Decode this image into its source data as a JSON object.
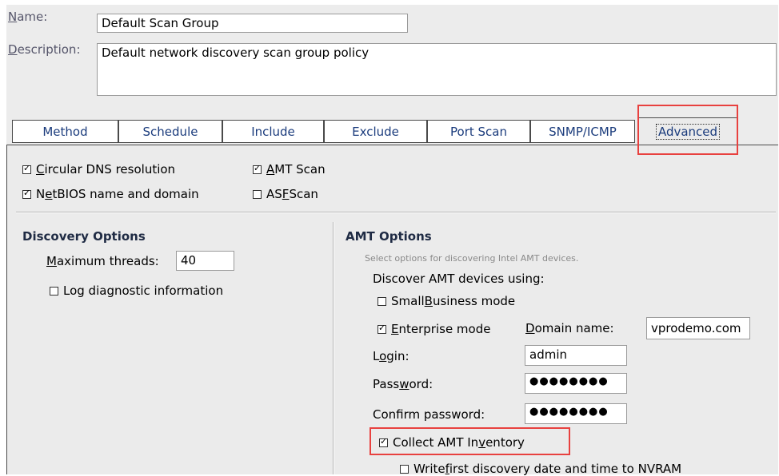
{
  "form": {
    "name_label": "Name:",
    "name_value": "Default Scan Group",
    "description_label": "Description:",
    "description_value": "Default network discovery scan group policy"
  },
  "tabs": [
    {
      "label": "Method"
    },
    {
      "label": "Schedule"
    },
    {
      "label": "Include"
    },
    {
      "label": "Exclude"
    },
    {
      "label": "Port Scan"
    },
    {
      "label": "SNMP/ICMP"
    },
    {
      "label": "Advanced",
      "active": true
    }
  ],
  "scan_options": {
    "circular_dns": {
      "pre": "",
      "mn": "C",
      "post": "ircular DNS resolution",
      "checked": true
    },
    "netbios": {
      "pre": "N",
      "mn": "e",
      "post": "tBIOS name and domain",
      "checked": true
    },
    "amt_scan": {
      "pre": "",
      "mn": "A",
      "post": "MT Scan",
      "checked": true
    },
    "asf_scan": {
      "pre": "AS",
      "mn": "F",
      "post": " Scan",
      "checked": false
    }
  },
  "discovery": {
    "title": "Discovery Options",
    "max_threads": {
      "pre": "",
      "mn": "M",
      "post": "aximum threads:",
      "value": "40"
    },
    "log_diag": {
      "label": "Log diagnostic information",
      "checked": false
    }
  },
  "amt": {
    "title": "AMT Options",
    "hint": "Select options for discovering Intel AMT devices.",
    "discover_label": "Discover AMT devices using:",
    "small_business": {
      "pre": "Small ",
      "mn": "B",
      "post": "usiness mode",
      "checked": false
    },
    "enterprise": {
      "pre": "",
      "mn": "E",
      "post": "nterprise mode",
      "checked": true
    },
    "domain": {
      "pre": "",
      "mn": "D",
      "post": "omain name:",
      "value": "vprodemo.com"
    },
    "login": {
      "pre": "L",
      "mn": "o",
      "post": "gin:",
      "value": "admin"
    },
    "password": {
      "pre": "Pass",
      "mn": "w",
      "post": "ord:",
      "value": "●●●●●●●●"
    },
    "confirm": {
      "label": "Confirm password:",
      "value": "●●●●●●●●"
    },
    "collect_inventory": {
      "pre": "Collect AMT In",
      "mn": "v",
      "post": "entory",
      "checked": true
    },
    "write_first": {
      "pre": "Write ",
      "mn": "f",
      "post": "irst discovery date and time to NVRAM",
      "checked": false
    }
  },
  "colors": {
    "highlight": "#e8413f",
    "tab_text": "#1a3b7c",
    "panel_bg": "#ebebeb"
  }
}
